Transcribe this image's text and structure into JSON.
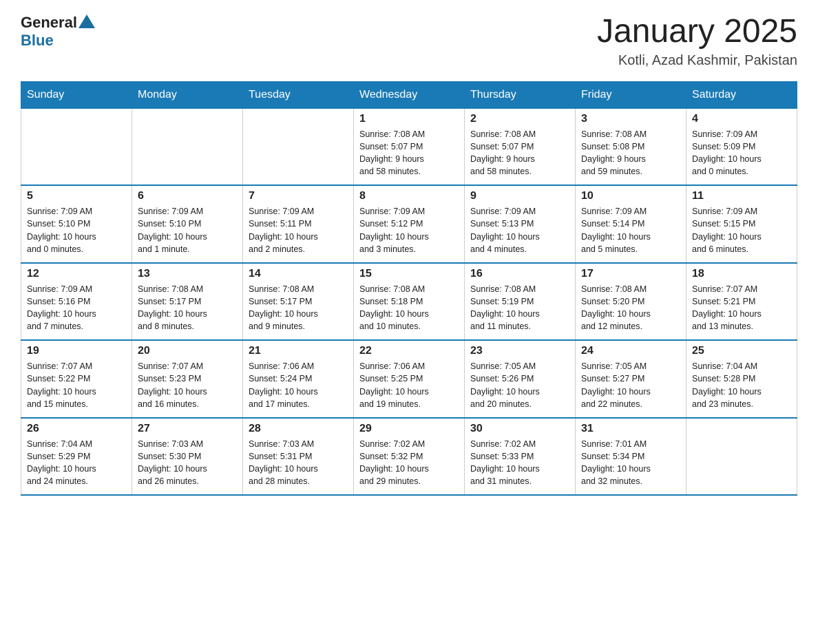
{
  "header": {
    "logo": {
      "general": "General",
      "blue": "Blue"
    },
    "title": "January 2025",
    "subtitle": "Kotli, Azad Kashmir, Pakistan"
  },
  "weekdays": [
    "Sunday",
    "Monday",
    "Tuesday",
    "Wednesday",
    "Thursday",
    "Friday",
    "Saturday"
  ],
  "weeks": [
    [
      {
        "day": "",
        "info": ""
      },
      {
        "day": "",
        "info": ""
      },
      {
        "day": "",
        "info": ""
      },
      {
        "day": "1",
        "info": "Sunrise: 7:08 AM\nSunset: 5:07 PM\nDaylight: 9 hours\nand 58 minutes."
      },
      {
        "day": "2",
        "info": "Sunrise: 7:08 AM\nSunset: 5:07 PM\nDaylight: 9 hours\nand 58 minutes."
      },
      {
        "day": "3",
        "info": "Sunrise: 7:08 AM\nSunset: 5:08 PM\nDaylight: 9 hours\nand 59 minutes."
      },
      {
        "day": "4",
        "info": "Sunrise: 7:09 AM\nSunset: 5:09 PM\nDaylight: 10 hours\nand 0 minutes."
      }
    ],
    [
      {
        "day": "5",
        "info": "Sunrise: 7:09 AM\nSunset: 5:10 PM\nDaylight: 10 hours\nand 0 minutes."
      },
      {
        "day": "6",
        "info": "Sunrise: 7:09 AM\nSunset: 5:10 PM\nDaylight: 10 hours\nand 1 minute."
      },
      {
        "day": "7",
        "info": "Sunrise: 7:09 AM\nSunset: 5:11 PM\nDaylight: 10 hours\nand 2 minutes."
      },
      {
        "day": "8",
        "info": "Sunrise: 7:09 AM\nSunset: 5:12 PM\nDaylight: 10 hours\nand 3 minutes."
      },
      {
        "day": "9",
        "info": "Sunrise: 7:09 AM\nSunset: 5:13 PM\nDaylight: 10 hours\nand 4 minutes."
      },
      {
        "day": "10",
        "info": "Sunrise: 7:09 AM\nSunset: 5:14 PM\nDaylight: 10 hours\nand 5 minutes."
      },
      {
        "day": "11",
        "info": "Sunrise: 7:09 AM\nSunset: 5:15 PM\nDaylight: 10 hours\nand 6 minutes."
      }
    ],
    [
      {
        "day": "12",
        "info": "Sunrise: 7:09 AM\nSunset: 5:16 PM\nDaylight: 10 hours\nand 7 minutes."
      },
      {
        "day": "13",
        "info": "Sunrise: 7:08 AM\nSunset: 5:17 PM\nDaylight: 10 hours\nand 8 minutes."
      },
      {
        "day": "14",
        "info": "Sunrise: 7:08 AM\nSunset: 5:17 PM\nDaylight: 10 hours\nand 9 minutes."
      },
      {
        "day": "15",
        "info": "Sunrise: 7:08 AM\nSunset: 5:18 PM\nDaylight: 10 hours\nand 10 minutes."
      },
      {
        "day": "16",
        "info": "Sunrise: 7:08 AM\nSunset: 5:19 PM\nDaylight: 10 hours\nand 11 minutes."
      },
      {
        "day": "17",
        "info": "Sunrise: 7:08 AM\nSunset: 5:20 PM\nDaylight: 10 hours\nand 12 minutes."
      },
      {
        "day": "18",
        "info": "Sunrise: 7:07 AM\nSunset: 5:21 PM\nDaylight: 10 hours\nand 13 minutes."
      }
    ],
    [
      {
        "day": "19",
        "info": "Sunrise: 7:07 AM\nSunset: 5:22 PM\nDaylight: 10 hours\nand 15 minutes."
      },
      {
        "day": "20",
        "info": "Sunrise: 7:07 AM\nSunset: 5:23 PM\nDaylight: 10 hours\nand 16 minutes."
      },
      {
        "day": "21",
        "info": "Sunrise: 7:06 AM\nSunset: 5:24 PM\nDaylight: 10 hours\nand 17 minutes."
      },
      {
        "day": "22",
        "info": "Sunrise: 7:06 AM\nSunset: 5:25 PM\nDaylight: 10 hours\nand 19 minutes."
      },
      {
        "day": "23",
        "info": "Sunrise: 7:05 AM\nSunset: 5:26 PM\nDaylight: 10 hours\nand 20 minutes."
      },
      {
        "day": "24",
        "info": "Sunrise: 7:05 AM\nSunset: 5:27 PM\nDaylight: 10 hours\nand 22 minutes."
      },
      {
        "day": "25",
        "info": "Sunrise: 7:04 AM\nSunset: 5:28 PM\nDaylight: 10 hours\nand 23 minutes."
      }
    ],
    [
      {
        "day": "26",
        "info": "Sunrise: 7:04 AM\nSunset: 5:29 PM\nDaylight: 10 hours\nand 24 minutes."
      },
      {
        "day": "27",
        "info": "Sunrise: 7:03 AM\nSunset: 5:30 PM\nDaylight: 10 hours\nand 26 minutes."
      },
      {
        "day": "28",
        "info": "Sunrise: 7:03 AM\nSunset: 5:31 PM\nDaylight: 10 hours\nand 28 minutes."
      },
      {
        "day": "29",
        "info": "Sunrise: 7:02 AM\nSunset: 5:32 PM\nDaylight: 10 hours\nand 29 minutes."
      },
      {
        "day": "30",
        "info": "Sunrise: 7:02 AM\nSunset: 5:33 PM\nDaylight: 10 hours\nand 31 minutes."
      },
      {
        "day": "31",
        "info": "Sunrise: 7:01 AM\nSunset: 5:34 PM\nDaylight: 10 hours\nand 32 minutes."
      },
      {
        "day": "",
        "info": ""
      }
    ]
  ]
}
